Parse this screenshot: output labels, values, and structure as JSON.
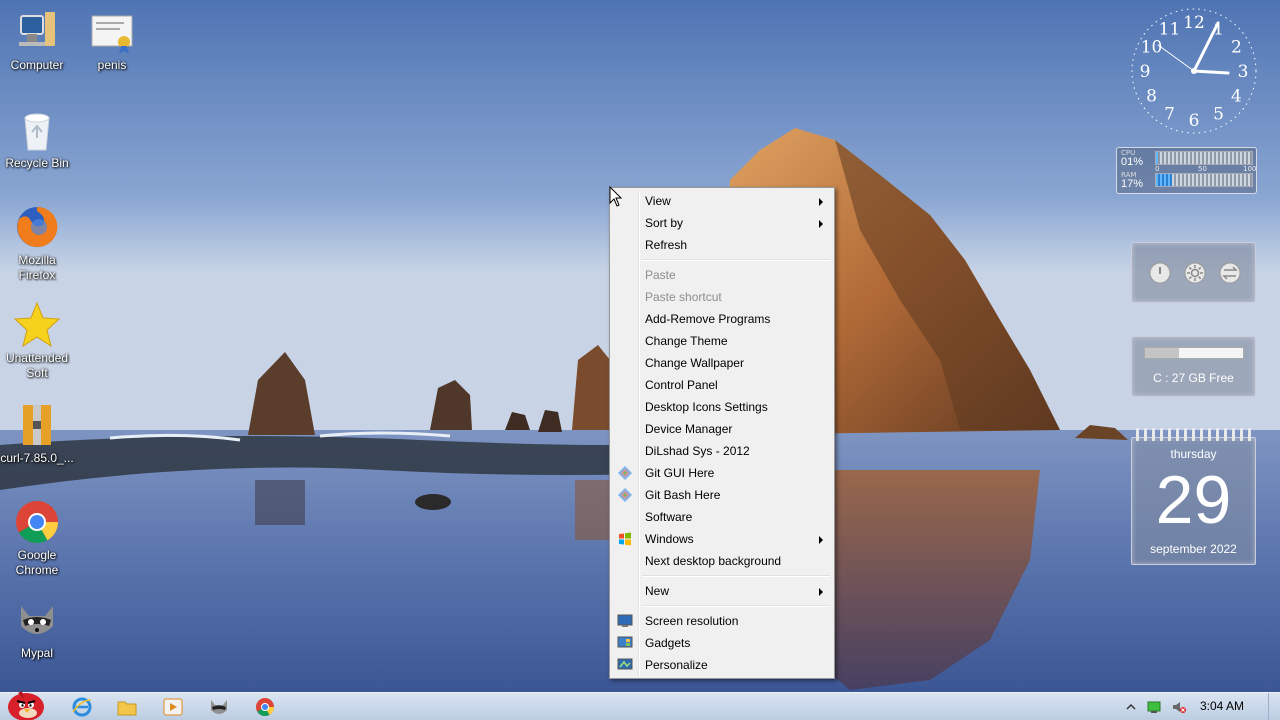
{
  "desktop_icons": [
    {
      "label": "Computer",
      "icon": "computer-icon"
    },
    {
      "label": "penis",
      "icon": "certificate-file-icon"
    },
    {
      "label": "Recycle Bin",
      "icon": "recycle-bin-icon"
    },
    {
      "label": "Mozilla Firefox",
      "icon": "firefox-icon"
    },
    {
      "label": "Unattended Soft",
      "icon": "star-icon"
    },
    {
      "label": "curl-7.85.0_...",
      "icon": "archive-icon"
    },
    {
      "label": "Google Chrome",
      "icon": "chrome-icon"
    },
    {
      "label": "Mypal",
      "icon": "raccoon-icon"
    }
  ],
  "context_menu": {
    "items": [
      {
        "label": "View",
        "submenu": true
      },
      {
        "label": "Sort by",
        "submenu": true
      },
      {
        "label": "Refresh"
      },
      {
        "label": "Paste",
        "disabled": true
      },
      {
        "label": "Paste shortcut",
        "disabled": true
      },
      {
        "label": "Add-Remove Programs"
      },
      {
        "label": "Change Theme"
      },
      {
        "label": "Change Wallpaper"
      },
      {
        "label": "Control Panel"
      },
      {
        "label": "Desktop Icons Settings"
      },
      {
        "label": "Device Manager"
      },
      {
        "label": "DiLshad Sys - 2012"
      },
      {
        "label": "Git GUI Here",
        "icon": "git-icon"
      },
      {
        "label": "Git Bash Here",
        "icon": "git-icon"
      },
      {
        "label": "Software"
      },
      {
        "label": "Windows",
        "submenu": true,
        "icon": "windows-logo-icon"
      },
      {
        "label": "Next desktop background"
      },
      {
        "label": "New",
        "submenu": true
      },
      {
        "label": "Screen resolution",
        "icon": "display-icon"
      },
      {
        "label": "Gadgets",
        "icon": "gadgets-icon"
      },
      {
        "label": "Personalize",
        "icon": "personalize-icon"
      }
    ]
  },
  "gadgets": {
    "clock": {
      "numbers": [
        "12",
        "1",
        "2",
        "3",
        "4",
        "5",
        "6",
        "7",
        "8",
        "9",
        "10",
        "11"
      ],
      "time": "3:04"
    },
    "cpu_meter": {
      "cpu_tag": "CPU",
      "cpu_value": "01%",
      "cpu_level": 0.01,
      "ram_tag": "RAM",
      "ram_value": "17%",
      "ram_level": 0.17,
      "scale": [
        "0",
        "50",
        "100"
      ]
    },
    "controls": [
      "power-icon",
      "brightness-icon",
      "switch-user-icon"
    ],
    "drive": {
      "text": "C : 27 GB Free",
      "used_fraction": 0.35
    },
    "calendar": {
      "day": "thursday",
      "date": "29",
      "month": "september 2022"
    }
  },
  "taskbar": {
    "start_icon": "angry-bird-start-icon",
    "pinned": [
      "internet-explorer-icon",
      "explorer-folder-icon",
      "media-player-icon",
      "mypal-icon",
      "chrome-icon"
    ],
    "tray": [
      "show-hidden-icons-icon",
      "network-icon",
      "volume-muted-icon"
    ],
    "time": "3:04 AM"
  },
  "colors": {
    "menu_bg": "#f0f0f0",
    "menu_border": "#979797",
    "disabled_text": "#8d8d8d",
    "taskbar": "#c8d7ea"
  }
}
